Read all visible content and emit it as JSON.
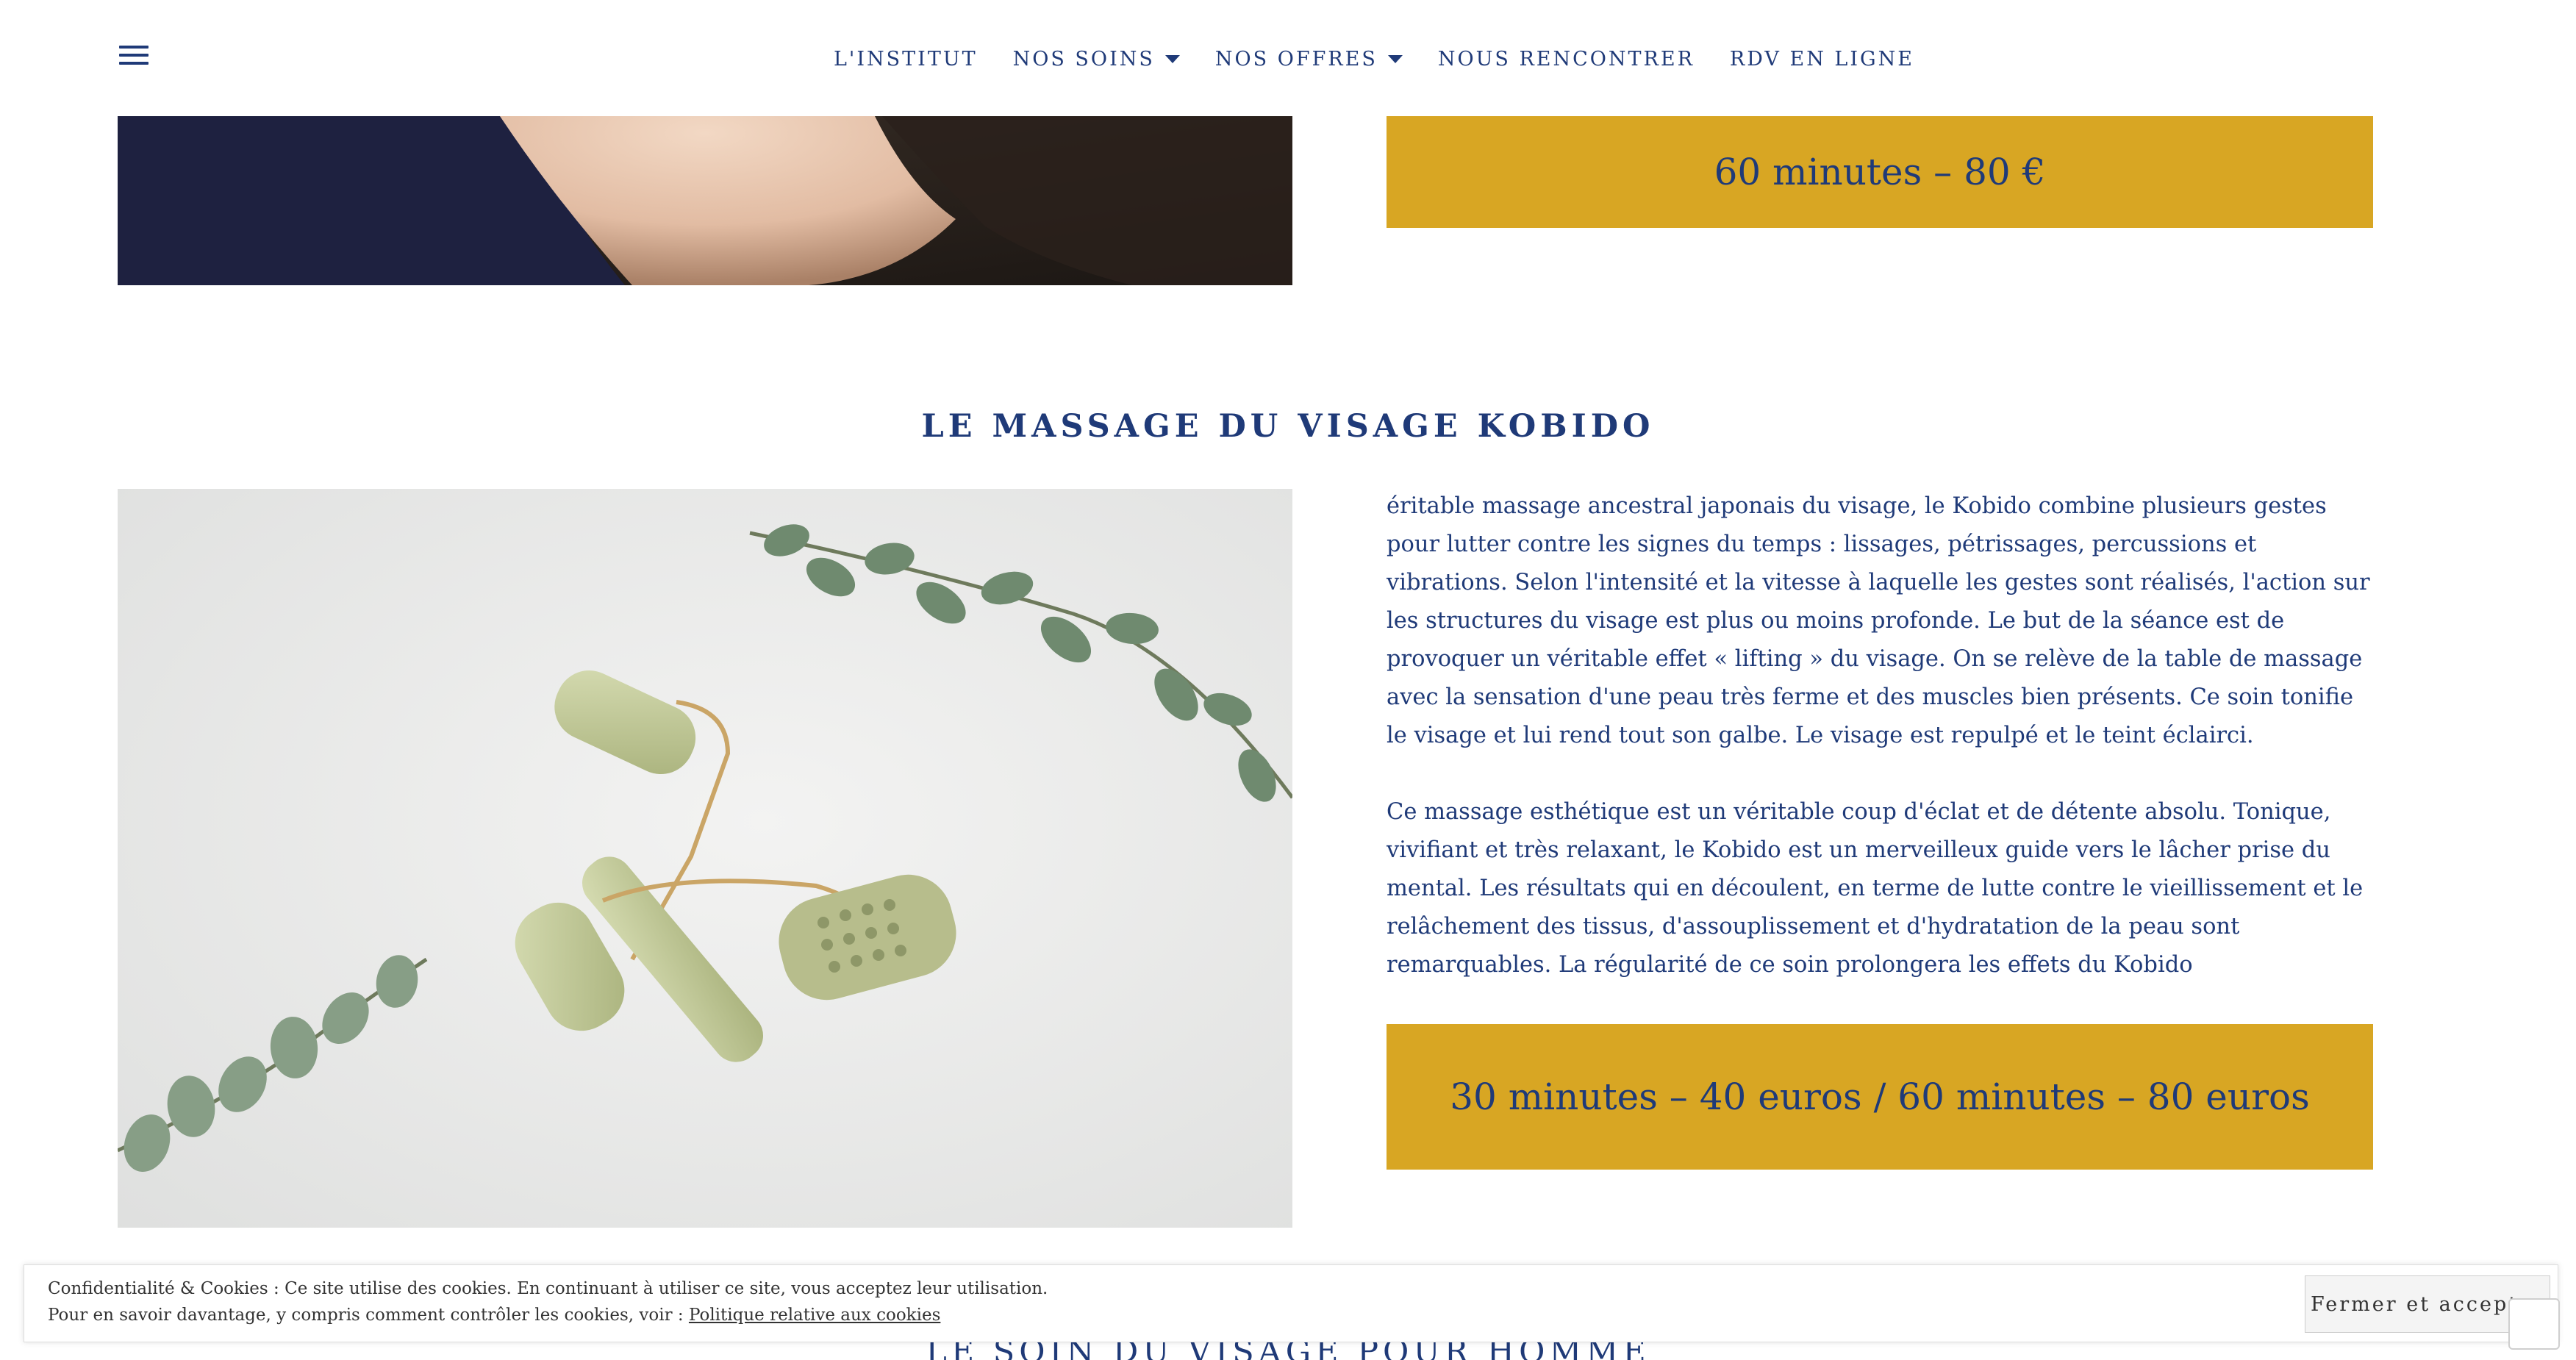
{
  "header": {
    "menu_icon": "hamburger-menu-icon",
    "nav": [
      {
        "label": "L'INSTITUT",
        "has_dropdown": false
      },
      {
        "label": "NOS SOINS",
        "has_dropdown": true
      },
      {
        "label": "NOS OFFRES",
        "has_dropdown": true
      },
      {
        "label": "NOUS RENCONTRER",
        "has_dropdown": false
      },
      {
        "label": "RDV EN LIGNE",
        "has_dropdown": false
      }
    ]
  },
  "top_section": {
    "price": "60 minutes – 80 €"
  },
  "kobido": {
    "title": "LE MASSAGE DU VISAGE KOBIDO",
    "paragraph_1": "éritable massage ancestral japonais du visage, le Kobido combine plusieurs gestes pour lutter contre les signes du temps : lissages, pétrissages, percussions et vibrations. Selon l'intensité et la vitesse à laquelle les gestes sont réalisés, l'action sur les structures du visage est plus ou moins profonde. Le but de la séance est de provoquer un véritable effet « lifting » du visage. On se relève de la table de massage avec la sensation d'une peau très ferme et des muscles bien présents. Ce soin tonifie le visage et lui rend tout son galbe. Le visage est repulpé et le teint éclairci.",
    "paragraph_2": "Ce massage esthétique est un véritable coup d'éclat et de détente absolu. Tonique, vivifiant et très relaxant, le Kobido est un merveilleux guide vers le lâcher prise du mental. Les résultats qui en découlent, en terme de lutte contre le vieillissement et le relâchement des tissus, d'assouplissement et d'hydratation de la peau sont remarquables. La régularité de ce soin prolongera les effets du Kobido",
    "price": "30 minutes – 40 euros / 60 minutes – 80 euros"
  },
  "next_section": {
    "title": "LE SOIN DU VISAGE POUR HOMME"
  },
  "cookie_banner": {
    "line_1": "Confidentialité & Cookies : Ce site utilise des cookies. En continuant à utiliser ce site, vous acceptez leur utilisation.",
    "line_2_prefix": "Pour en savoir davantage, y compris comment contrôler les cookies, voir : ",
    "link_label": "Politique relative aux cookies",
    "accept_label": "Fermer et accepter"
  },
  "colors": {
    "primary_text": "#1f3a78",
    "price_box": "#d8a623"
  }
}
